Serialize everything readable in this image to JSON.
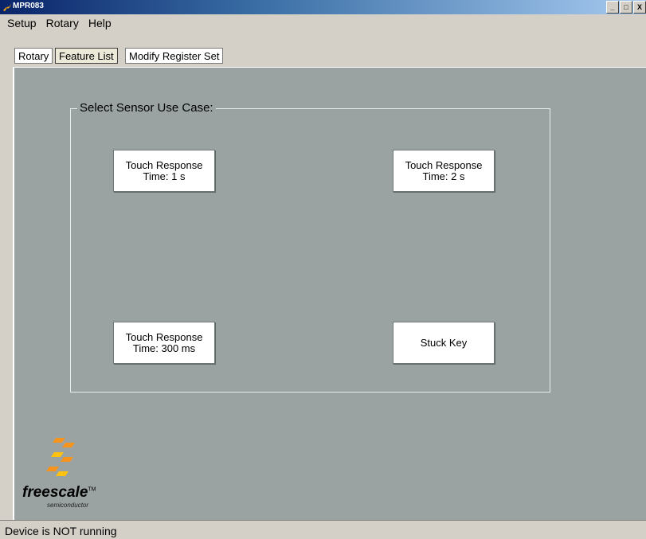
{
  "window": {
    "title": "MPR083",
    "controls": [
      "_",
      "□",
      "X"
    ]
  },
  "menu": {
    "items": [
      "Setup",
      "Rotary",
      "Help"
    ]
  },
  "tabs": [
    {
      "label": "Rotary"
    },
    {
      "label": "Feature List",
      "active": true
    },
    {
      "label": "Modify Register Set"
    }
  ],
  "group": {
    "label": "Select Sensor Use Case:"
  },
  "use_cases": {
    "b1": {
      "line1": "Touch Response",
      "line2": "Time: 1 s"
    },
    "b2": {
      "line1": "Touch Response",
      "line2": "Time: 2 s"
    },
    "b3": {
      "line1": "Touch Response",
      "line2": "Time: 300 ms"
    },
    "b4": {
      "line1": "Stuck Key",
      "line2": ""
    }
  },
  "logo": {
    "name": "freescale",
    "sub": "semiconductor",
    "tm": "TM"
  },
  "status": {
    "text": "Device is NOT running"
  },
  "colors": {
    "panel": "#9aa3a2",
    "chrome": "#d4d0c8",
    "logo_orange": "#f7941d",
    "logo_yellow": "#ffc20e"
  }
}
